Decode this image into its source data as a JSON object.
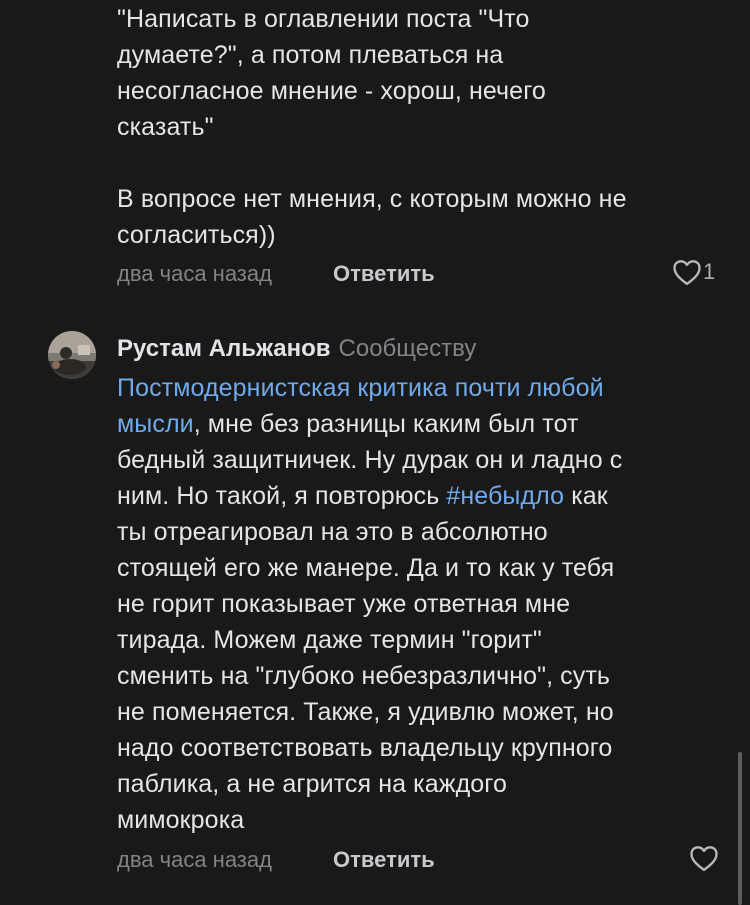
{
  "comment1": {
    "lines": [
      "\"Написать в оглавлении поста \"Что",
      "думаете?\", а потом плеваться на",
      "несогласное мнение - хорош, нечего",
      "сказать\"",
      "В вопросе нет мнения, с которым можно не",
      "согласиться))"
    ],
    "time": "два часа назад",
    "reply_label": "Ответить",
    "like_count": "1",
    "like_icon": "heart-outline-icon"
  },
  "comment2": {
    "author": "Рустам Альжанов",
    "author_sub": "Сообществу",
    "avatar": "user-avatar",
    "text": {
      "l1_link": "Постмодернистская критика почти любой",
      "l2_link": "мысли",
      "l2_rest": ", мне без разницы каким был тот",
      "l3": "бедный защитничек. Ну дурак он и ладно с",
      "l4": "ним. Но такой, я повторюсь ",
      "l4_tag": "#небыдло",
      "l4_rest": " как",
      "l5": "ты отреагировал на это в абсолютно",
      "l6": "стоящей его же манере. Да и то как у тебя",
      "l7": "не горит показывает уже ответная мне",
      "l8": "тирада. Можем даже термин \"горит\"",
      "l9": "сменить на \"глубоко небезразлично\", суть",
      "l10": "не поменяется. Также, я удивлю может, но",
      "l11": "надо соответствовать владельцу крупного",
      "l12": "паблика, а не агрится на каждого",
      "l13": "мимокрока"
    },
    "time": "два часа назад",
    "reply_label": "Ответить",
    "like_icon": "heart-outline-icon"
  },
  "colors": {
    "background": "#19191a",
    "text": "#e5e5e7",
    "link": "#71aaeb",
    "muted": "#828387"
  }
}
